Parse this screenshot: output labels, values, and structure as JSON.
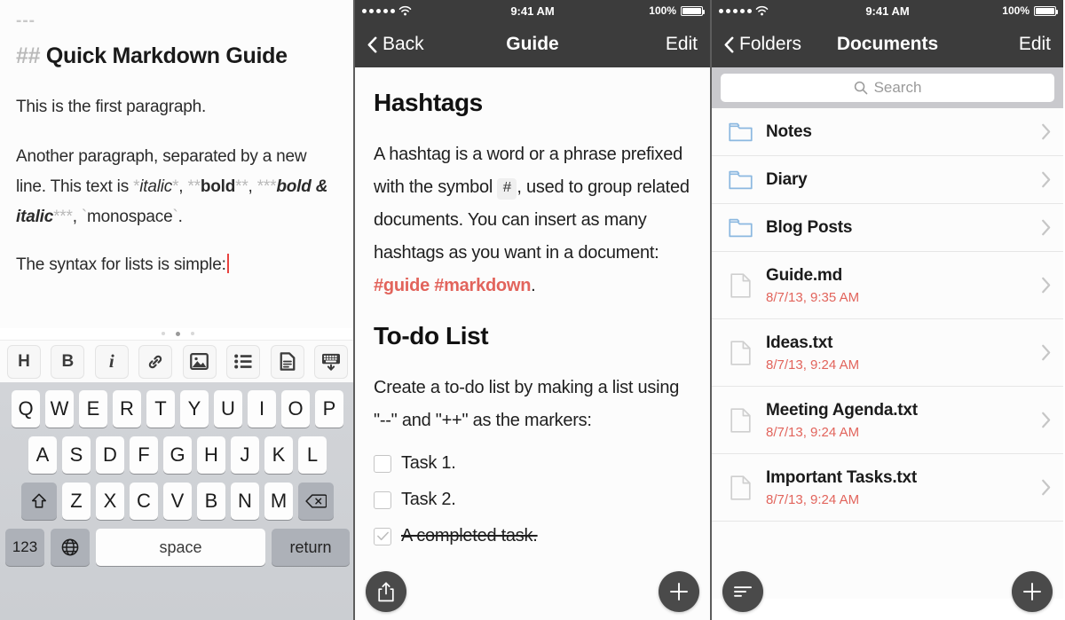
{
  "left_panel": {
    "editor": {
      "rule": "---",
      "heading_marker": "## ",
      "heading_text": "Quick Markdown Guide",
      "para1": "This is the first paragraph.",
      "para2_a": "Another paragraph, separated by a new line. This text is ",
      "italic_marker": "*",
      "italic_text": "italic",
      "comma1": ", ",
      "bold_marker": "**",
      "bold_text": "bold",
      "comma2": ", ",
      "bolditalic_marker": "***",
      "bolditalic_text": "bold & italic",
      "comma3": ", ",
      "mono_marker": "`",
      "mono_text": "monospace",
      "period": ".",
      "para3": "The syntax for lists is simple:"
    },
    "toolbar": {
      "buttons": [
        {
          "name": "heading-button",
          "label": "H",
          "icon": "heading-icon"
        },
        {
          "name": "bold-button",
          "label": "B",
          "icon": "bold-icon"
        },
        {
          "name": "italic-button",
          "label": "i",
          "icon": "italic-icon"
        },
        {
          "name": "link-button",
          "label": "",
          "icon": "link-icon"
        },
        {
          "name": "image-button",
          "label": "",
          "icon": "image-icon"
        },
        {
          "name": "list-button",
          "label": "",
          "icon": "bullet-list-icon"
        },
        {
          "name": "document-button",
          "label": "",
          "icon": "document-icon"
        },
        {
          "name": "hide-keyboard-button",
          "label": "",
          "icon": "hide-keyboard-icon"
        }
      ]
    },
    "keyboard": {
      "row1": [
        "Q",
        "W",
        "E",
        "R",
        "T",
        "Y",
        "U",
        "I",
        "O",
        "P"
      ],
      "row2": [
        "A",
        "S",
        "D",
        "F",
        "G",
        "H",
        "J",
        "K",
        "L"
      ],
      "row3": [
        "Z",
        "X",
        "C",
        "V",
        "B",
        "N",
        "M"
      ],
      "shift_label": "",
      "backspace_label": "",
      "numbers_label": "123",
      "globe_label": "",
      "space_label": "space",
      "return_label": "return"
    }
  },
  "mid_panel": {
    "status": {
      "time": "9:41 AM",
      "battery_pct": "100%",
      "signal_dots": 5
    },
    "nav": {
      "back_label": "Back",
      "title": "Guide",
      "edit_label": "Edit"
    },
    "doc": {
      "h1_hashtags": "Hashtags",
      "p1_a": "A hashtag is a word or a phrase prefixed with the symbol ",
      "p1_code": "#",
      "p1_b": ", used to group related documents. You can insert as many hashtags as you want in a document: ",
      "p1_tag1": "#guide",
      "p1_space": " ",
      "p1_tag2": "#markdown",
      "p1_end": ".",
      "h1_todo": "To-do List",
      "p2": "Create a to-do list by making a list using \"--\" and \"++\" as the markers:",
      "tasks": [
        {
          "label": "Task 1.",
          "done": false
        },
        {
          "label": "Task 2.",
          "done": false
        },
        {
          "label": "A completed task.",
          "done": true
        }
      ]
    },
    "fab": {
      "left_icon": "share-icon",
      "right_icon": "plus-icon"
    }
  },
  "right_panel": {
    "status": {
      "time": "9:41 AM",
      "battery_pct": "100%",
      "signal_dots": 5
    },
    "nav": {
      "back_label": "Folders",
      "title": "Documents",
      "edit_label": "Edit"
    },
    "search": {
      "placeholder": "Search",
      "icon": "search-icon"
    },
    "items": [
      {
        "type": "folder",
        "name": "Notes",
        "date": ""
      },
      {
        "type": "folder",
        "name": "Diary",
        "date": ""
      },
      {
        "type": "folder",
        "name": "Blog Posts",
        "date": ""
      },
      {
        "type": "file",
        "name": "Guide.md",
        "date": "8/7/13, 9:35 AM"
      },
      {
        "type": "file",
        "name": "Ideas.txt",
        "date": "8/7/13, 9:24 AM"
      },
      {
        "type": "file",
        "name": "Meeting Agenda.txt",
        "date": "8/7/13, 9:24 AM"
      },
      {
        "type": "file",
        "name": "Important Tasks.txt",
        "date": "8/7/13, 9:24 AM"
      }
    ],
    "fab": {
      "left_icon": "sort-icon",
      "right_icon": "plus-icon"
    }
  },
  "colors": {
    "nav_bar": "#3c3c3c",
    "accent_red": "#e2645c",
    "caret_red": "#e8433f",
    "folder_blue": "#8bb8e0",
    "fab_dark": "#4a4a4a",
    "keyboard_bg": "#cbced2"
  }
}
